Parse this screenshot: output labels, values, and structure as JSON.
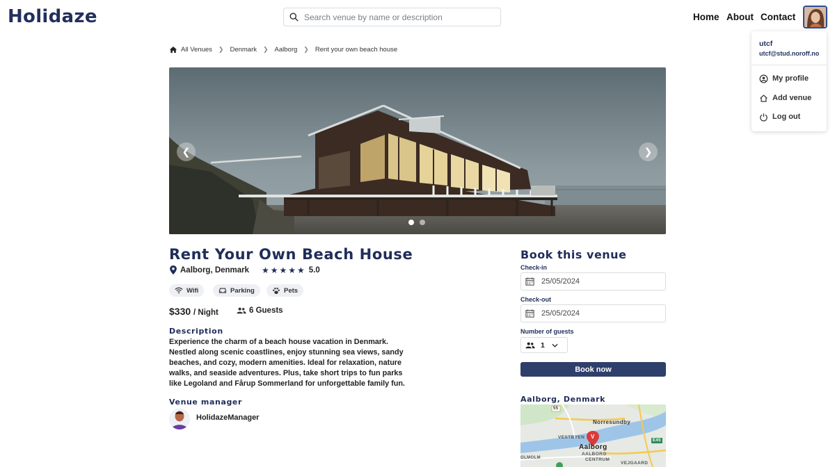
{
  "header": {
    "logo": "Holidaze",
    "search_placeholder": "Search venue by name or description",
    "nav": [
      "Home",
      "About",
      "Contact"
    ]
  },
  "user_menu": {
    "username": "utcf",
    "email": "utcf@stud.noroff.no",
    "items": [
      "My profile",
      "Add venue",
      "Log out"
    ]
  },
  "breadcrumb": [
    "All Venues",
    "Denmark",
    "Aalborg",
    "Rent your own beach house"
  ],
  "gallery": {
    "image_count": 2,
    "active_index": 0
  },
  "venue": {
    "title": "Rent Your Own Beach House",
    "location": "Aalborg, Denmark",
    "stars": "★★★★★",
    "rating": "5.0",
    "amenities": [
      "Wifi",
      "Parking",
      "Pets"
    ],
    "price": "$330",
    "price_unit": "/ Night",
    "guests": "6 Guests",
    "description_heading": "Description",
    "description": "Experience the charm of a beach house vacation in Denmark. Nestled along scenic coastlines, enjoy stunning sea views, sandy beaches, and cozy, modern amenities. Ideal for relaxation, nature walks, and seaside adventures. Plus, take short trips to fun parks like Legoland and Fårup Sommerland for unforgettable family fun.",
    "manager_heading": "Venue manager",
    "manager_name": "HolidazeManager"
  },
  "booking": {
    "title": "Book this venue",
    "checkin_label": "Check-in",
    "checkin_value": "25/05/2024",
    "checkout_label": "Check-out",
    "checkout_value": "25/05/2024",
    "guests_label": "Number of guests",
    "guests_value": "1",
    "button": "Book now"
  },
  "map": {
    "title": "Aalborg, Denmark",
    "labels": [
      "55",
      "Norresundby",
      "VESTBYEN",
      "Aalborg",
      "AALBORG",
      "CENTRUM",
      "E45",
      "VEJGAARD",
      "OLMOLM"
    ],
    "marker_letter": "V"
  },
  "colors": {
    "brand": "#1f2d59",
    "button": "#2f3f6b",
    "marker": "#d93a3a"
  }
}
